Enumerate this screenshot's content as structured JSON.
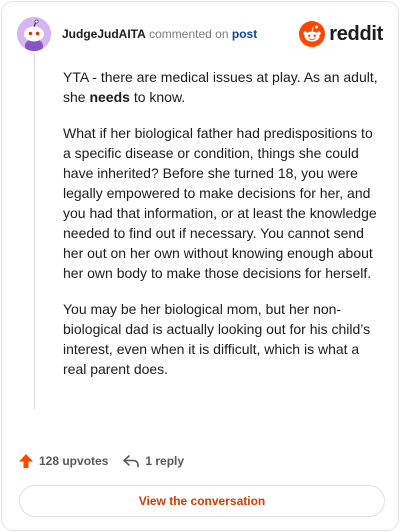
{
  "header": {
    "username": "JudgeJudAITA",
    "action_text": "commented on",
    "post_link": "post",
    "brand": "reddit"
  },
  "comment": {
    "p1_a": "YTA - there are medical issues at play. As an adult, she ",
    "p1_bold": "needs",
    "p1_b": " to know.",
    "p2": "What if her biological father had predispositions to a specific disease or condition, things she could have inherited? Before she turned 18, you were legally empowered to make decisions for her, and you had that information, or at least the knowledge needed to find out if necessary. You cannot send her out on her own without knowing enough about her own body to make those decisions for herself.",
    "p3": "You may be her biological mom, but her non-biological dad is actually looking out for his child’s interest, even when it is difficult, which is what a real parent does."
  },
  "actions": {
    "upvotes": "128 upvotes",
    "replies": "1 reply"
  },
  "cta_label": "View the conversation",
  "colors": {
    "brand_orange": "#ff4500",
    "link_blue": "#0a449b",
    "cta_text": "#d93a00",
    "avatar_bg": "#d6b6f2"
  },
  "icons": {
    "avatar": "snoo-avatar-icon",
    "logo": "reddit-snoo-icon",
    "upvote": "upvote-arrow-icon",
    "reply": "reply-arrow-icon"
  }
}
